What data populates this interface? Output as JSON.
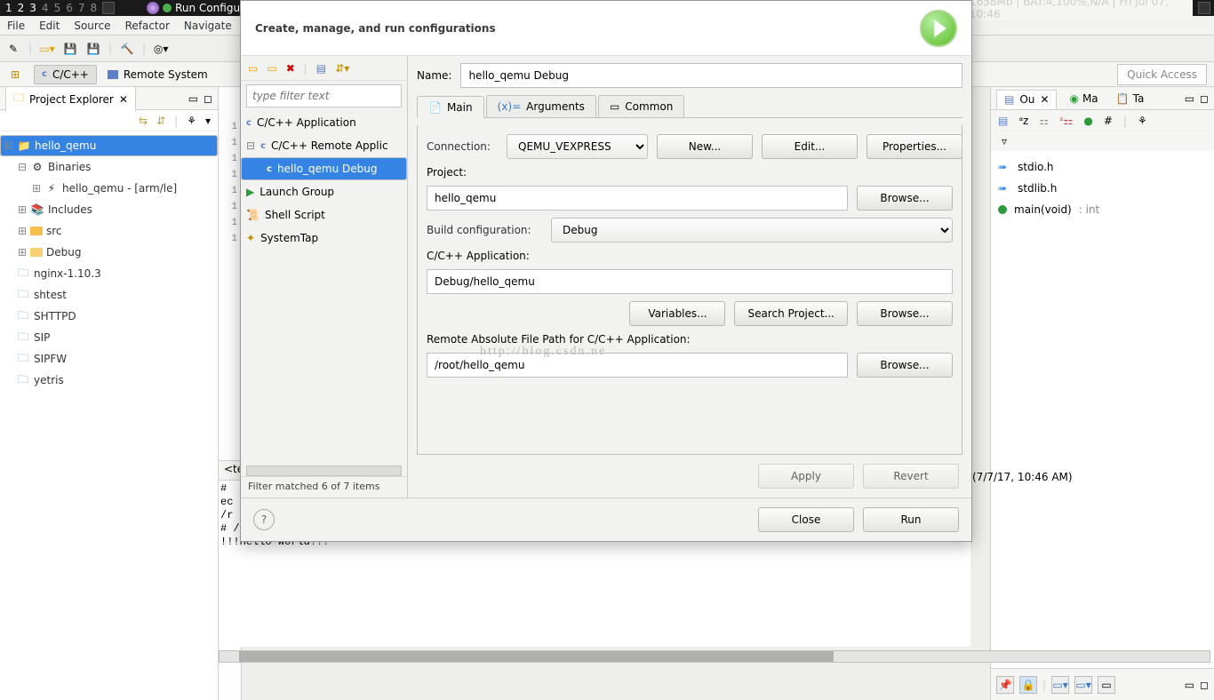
{
  "sysbar": {
    "workspaces": [
      "1",
      "2",
      "3",
      "4",
      "5",
      "6",
      "7",
      "8"
    ],
    "active_workspace": 3,
    "mini_title": "Run Configurat",
    "right": "1658Mb | BAT:4,100%,N/A | Fri Jul 07, 10:46"
  },
  "menubar": [
    "File",
    "Edit",
    "Source",
    "Refactor",
    "Navigate"
  ],
  "perspective": {
    "cpp": "C/C++",
    "remote": "Remote System"
  },
  "quick_access_placeholder": "Quick Access",
  "project_explorer": {
    "title": "Project Explorer",
    "items": [
      {
        "label": "hello_qemu",
        "type": "project",
        "selected": true
      },
      {
        "label": "Binaries",
        "type": "binaries",
        "indent": 1
      },
      {
        "label": "hello_qemu - [arm/le]",
        "type": "exe",
        "indent": 2
      },
      {
        "label": "Includes",
        "type": "includes",
        "indent": 1
      },
      {
        "label": "src",
        "type": "src",
        "indent": 1
      },
      {
        "label": "Debug",
        "type": "debug",
        "indent": 1
      },
      {
        "label": "nginx-1.10.3",
        "type": "closed"
      },
      {
        "label": "shtest",
        "type": "closed"
      },
      {
        "label": "SHTTPD",
        "type": "closed"
      },
      {
        "label": "SIP",
        "type": "closed"
      },
      {
        "label": "SIPFW",
        "type": "closed"
      },
      {
        "label": "yetris",
        "type": "closed"
      }
    ]
  },
  "editor_lines": [
    "1",
    "1",
    "1",
    "1",
    "1",
    "1",
    "1",
    "1"
  ],
  "terminal": {
    "frag": "<ter",
    "lines": "# \nec\n/r\n# /root/hello_qemu,exit\n!!!Hello World!!!"
  },
  "outline": {
    "tabs": [
      "Ou",
      "Ma",
      "Ta"
    ],
    "items": [
      {
        "kind": "h",
        "label": "stdio.h"
      },
      {
        "kind": "h",
        "label": "stdlib.h"
      },
      {
        "kind": "fn",
        "label": "main(void)",
        "ret": ": int"
      }
    ]
  },
  "timestamp_line": "(7/7/17, 10:46 AM)",
  "dialog": {
    "header": "Create, manage, and run configurations",
    "filter_placeholder": "type filter text",
    "tree": [
      {
        "label": "C/C++ Application"
      },
      {
        "label": "C/C++ Remote Applic",
        "expanded": true
      },
      {
        "label": "hello_qemu Debug",
        "child": true,
        "selected": true
      },
      {
        "label": "Launch Group"
      },
      {
        "label": "Shell Script"
      },
      {
        "label": "SystemTap"
      }
    ],
    "filter_status": "Filter matched 6 of 7 items",
    "name_label": "Name:",
    "name_value": "hello_qemu Debug",
    "tabs": {
      "main": "Main",
      "args": "Arguments",
      "common": "Common"
    },
    "connection_label": "Connection:",
    "connection_value": "QEMU_VEXPRESS",
    "new_btn": "New...",
    "edit_btn": "Edit...",
    "props_btn": "Properties...",
    "project_label": "Project:",
    "project_value": "hello_qemu",
    "browse_btn": "Browse...",
    "buildcfg_label": "Build configuration:",
    "buildcfg_value": "Debug",
    "capp_label": "C/C++ Application:",
    "capp_value": "Debug/hello_qemu",
    "vars_btn": "Variables...",
    "searchproj_btn": "Search Project...",
    "remotepath_label": "Remote Absolute File Path for C/C++ Application:",
    "remotepath_value": "/root/hello_qemu",
    "apply_btn": "Apply",
    "revert_btn": "Revert",
    "close_btn": "Close",
    "run_btn": "Run"
  },
  "watermark": "http://blog.csdn.ne"
}
